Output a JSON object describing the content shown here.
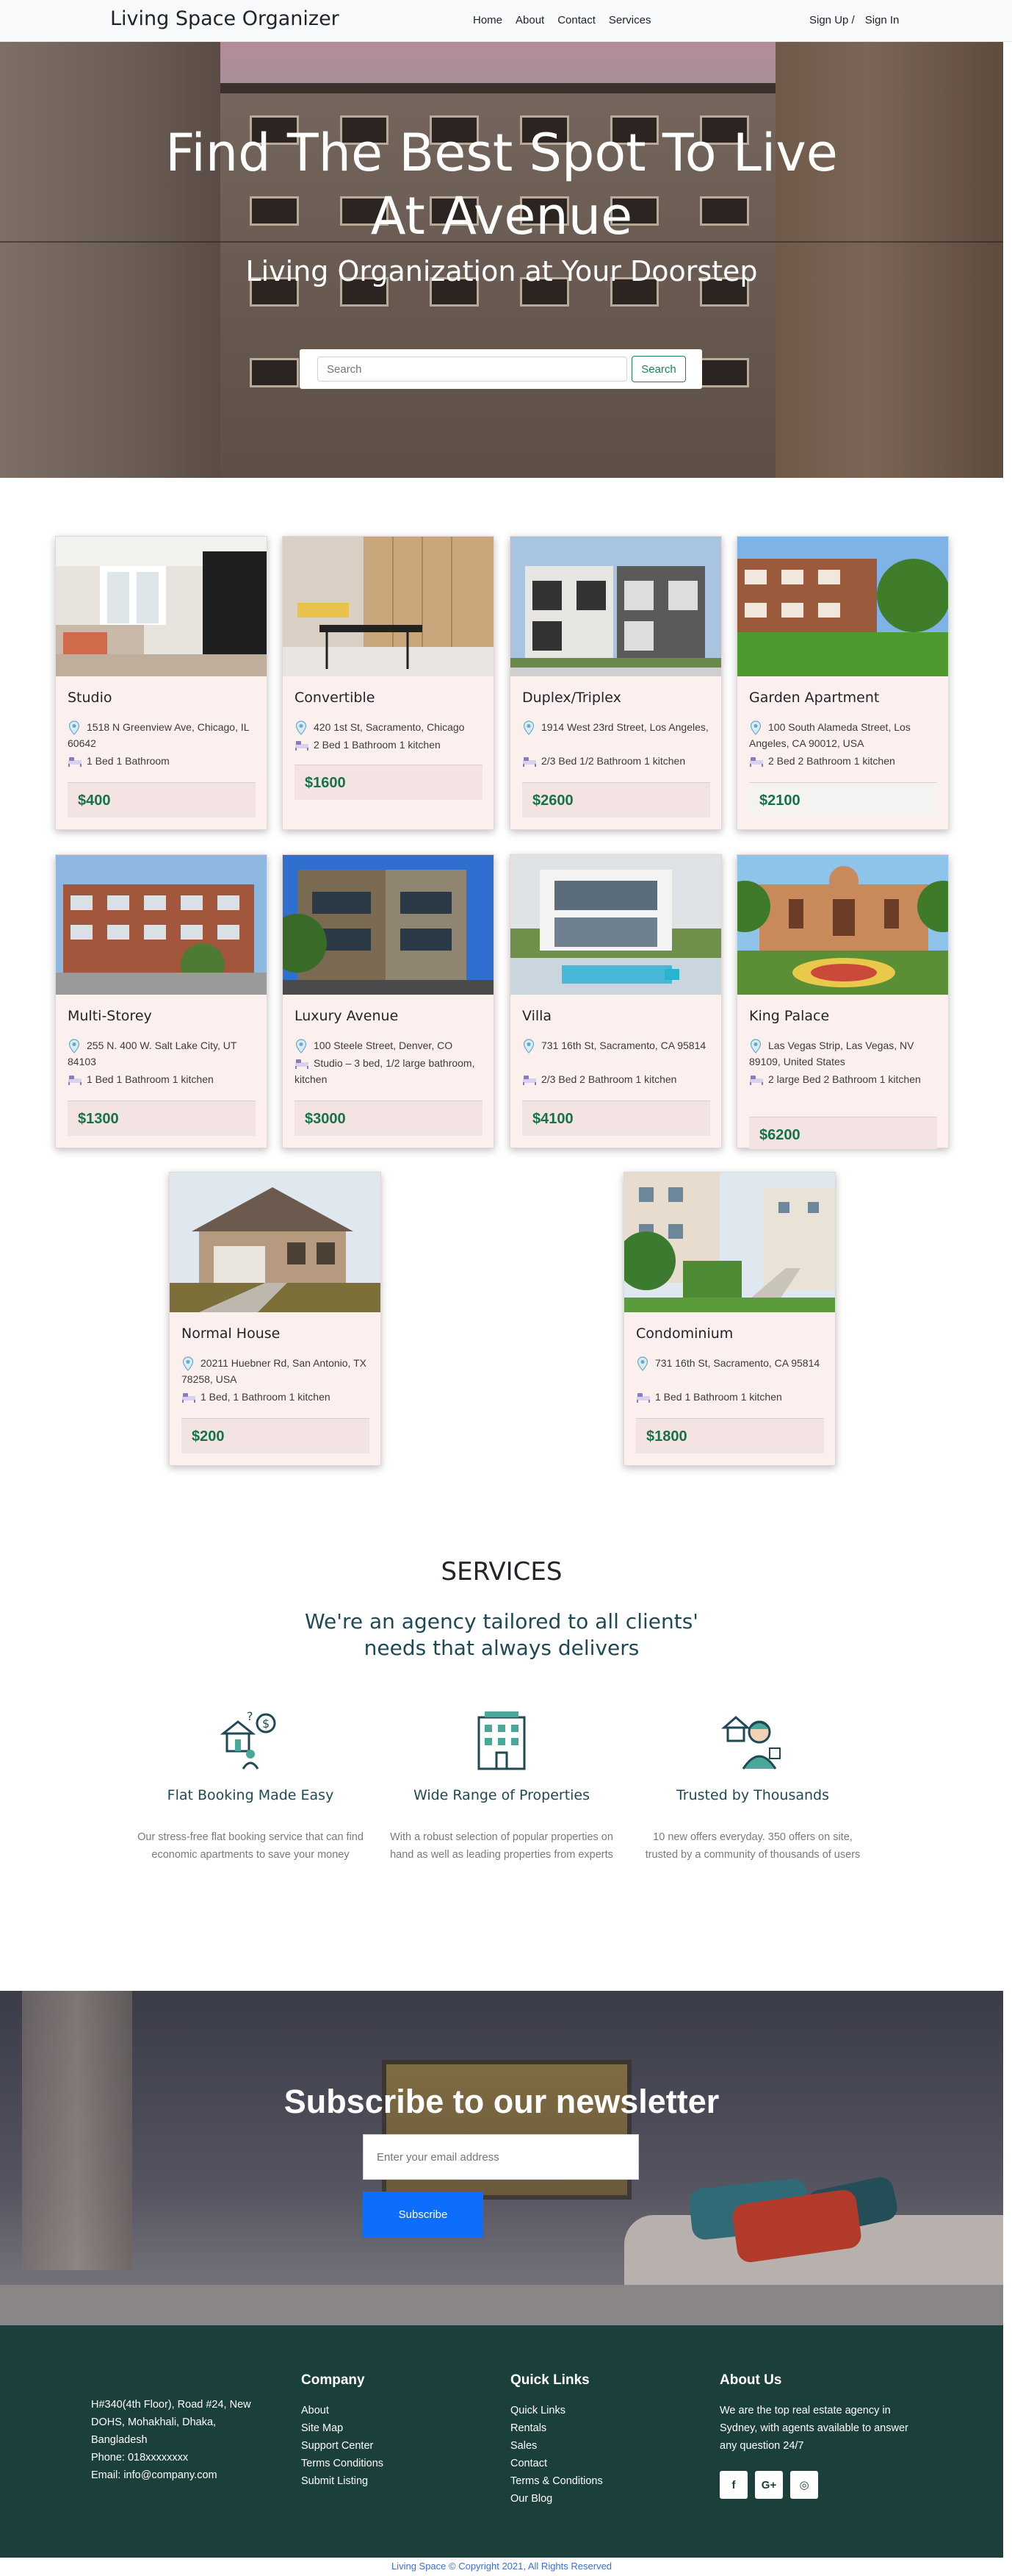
{
  "navbar": {
    "brand": "Living Space Organizer",
    "links": [
      "Home",
      "About",
      "Contact",
      "Services"
    ],
    "sign_up": "Sign Up /",
    "sign_in": "Sign In"
  },
  "hero": {
    "title_line1": "Find The Best Spot To Live",
    "title_line2": "At Avenue",
    "subtitle": "Living Organization at Your Doorstep",
    "search_placeholder": "Search",
    "search_button": "Search"
  },
  "listings": [
    {
      "title": "Studio",
      "address": "1518 N Greenview Ave, Chicago, IL 60642",
      "rooms": "1 Bed 1 Bathroom",
      "price": "$400"
    },
    {
      "title": "Convertible",
      "address": "420 1st St, Sacramento, Chicago",
      "rooms": "2 Bed 1 Bathroom 1 kitchen",
      "price": "$1600"
    },
    {
      "title": "Duplex/Triplex",
      "address": "1914 West 23rd Street, Los Angeles,",
      "rooms": "2/3 Bed 1/2 Bathroom 1 kitchen",
      "price": "$2600"
    },
    {
      "title": "Garden Apartment",
      "address": "100 South Alameda Street, Los Angeles, CA 90012, USA",
      "rooms": "2 Bed 2 Bathroom 1 kitchen",
      "price": "$2100"
    },
    {
      "title": "Multi-Storey",
      "address": "255 N. 400 W. Salt Lake City, UT 84103",
      "rooms": "1 Bed 1 Bathroom 1 kitchen",
      "price": "$1300"
    },
    {
      "title": "Luxury Avenue",
      "address": "100 Steele Street, Denver, CO",
      "rooms": "Studio – 3 bed, 1/2 large bathroom, kitchen",
      "price": "$3000"
    },
    {
      "title": "Villa",
      "address": "731 16th St, Sacramento, CA 95814",
      "rooms": "2/3 Bed 2 Bathroom 1 kitchen",
      "price": "$4100"
    },
    {
      "title": "King Palace",
      "address": "Las Vegas Strip, Las Vegas, NV 89109, United States",
      "rooms": "2 large Bed 2 Bathroom 1 kitchen",
      "price": "$6200"
    },
    {
      "title": "Normal House",
      "address": "20211 Huebner Rd, San Antonio, TX 78258, USA",
      "rooms": "1 Bed, 1 Bathroom 1 kitchen",
      "price": "$200"
    },
    {
      "title": "Condominium",
      "address": "731 16th St, Sacramento, CA 95814",
      "rooms": "1 Bed 1 Bathroom 1 kitchen",
      "price": "$1800"
    }
  ],
  "services": {
    "heading": "SERVICES",
    "subheading": "We're an agency tailored to all clients' needs that always delivers",
    "items": [
      {
        "name": "Flat Booking Made Easy",
        "description": "Our stress-free flat booking service that can find economic apartments to save your money",
        "icon": "house-money-icon"
      },
      {
        "name": "Wide Range of Properties",
        "description": "With a robust selection of popular properties on hand as well as leading properties from experts",
        "icon": "building-icon"
      },
      {
        "name": "Trusted by Thousands",
        "description": "10 new offers everyday. 350 offers on site, trusted by a community of thousands of users",
        "icon": "agent-icon"
      }
    ]
  },
  "newsletter": {
    "title": "Subscribe to our newsletter",
    "email_placeholder": "Enter your email address",
    "button": "Subscribe"
  },
  "footer": {
    "address_lines": [
      "H#340(4th Floor), Road #24, New DOHS, Mohakhali, Dhaka, Bangladesh",
      "Phone: 018xxxxxxxx",
      "Email: info@company.com"
    ],
    "company": {
      "heading": "Company",
      "links": [
        "About",
        "Site Map",
        "Support Center",
        "Terms Conditions",
        "Submit Listing"
      ]
    },
    "quick_links": {
      "heading": "Quick Links",
      "links": [
        "Quick Links",
        "Rentals",
        "Sales",
        "Contact",
        "Terms & Conditions",
        "Our Blog"
      ]
    },
    "about": {
      "heading": "About Us",
      "text": "We are the top real estate agency in Sydney, with agents available to answer any question 24/7"
    },
    "social": [
      "f",
      "G+",
      "◎"
    ],
    "copyright": "Living Space © Copyright 2021, All Rights Reserved"
  },
  "colors": {
    "price": "#157347",
    "footer_bg": "#1b3f3a",
    "accent_blue": "#0d6efd",
    "card_bg": "#fcf0ef"
  }
}
